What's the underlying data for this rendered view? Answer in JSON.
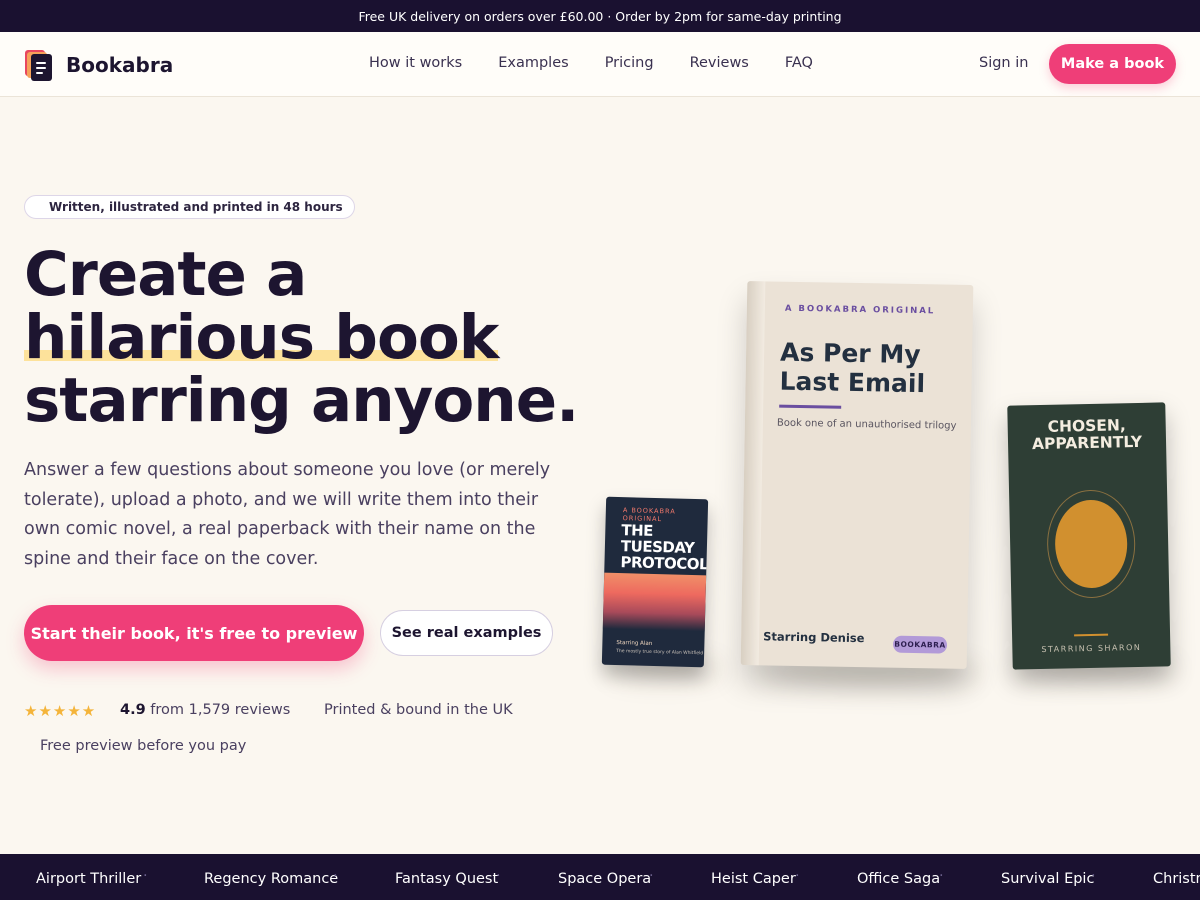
{
  "topbar": {
    "text": "Free UK delivery on orders over £60.00 · Order by 2pm for same-day printing"
  },
  "nav": {
    "brand": "Bookabra",
    "links": [
      "How it works",
      "Examples",
      "Pricing",
      "Reviews",
      "FAQ"
    ],
    "signin": "Sign in",
    "cta": "Make a book"
  },
  "hero": {
    "badge": "Written, illustrated and printed in 48 hours",
    "headline_line1": "Create a",
    "headline_line2": "hilarious book",
    "headline_line3": "starring anyone.",
    "lede": "Answer a few questions about someone you love (or merely tolerate), upload a photo, and we will write them into their own comic novel, a real paperback with their name on the spine and their face on the cover.",
    "primary_cta": "Start their book, it's free to preview",
    "secondary_cta": "See real examples",
    "stars": "★★★★★",
    "rating_value": "4.9",
    "rating_text": "from 1,579 reviews",
    "made_in": "Printed & bound in the UK",
    "free_preview": "Free preview before you pay"
  },
  "books": {
    "small": {
      "eyebrow": "A BOOKABRA ORIGINAL",
      "title": "THE TUESDAY PROTOCOL",
      "starring": "Starring Alan",
      "subtitle": "The mostly true story of Alan Whitfield"
    },
    "large": {
      "eyebrow": "A BOOKABRA ORIGINAL",
      "title": "As Per My Last Email",
      "subtitle": "Book one of an unauthorised trilogy",
      "starring": "Starring Denise",
      "badge": "BOOKABRA"
    },
    "right": {
      "title": "CHOSEN, APPARENTLY",
      "starring": "STARRING SHARON"
    }
  },
  "ticker": {
    "items": [
      "Airport Thriller",
      "Regency Romance",
      "Fantasy Quest",
      "Space Opera",
      "Heist Caper",
      "Office Saga",
      "Survival Epic",
      "Christmas"
    ]
  },
  "colors": {
    "accent": "#ef3e78",
    "dark": "#1a1130",
    "highlight": "#fde29b",
    "background": "#fbf7f0",
    "star": "#f4b43a"
  },
  "icons": {
    "logo": "stacked-books-icon",
    "star": "star-icon"
  }
}
